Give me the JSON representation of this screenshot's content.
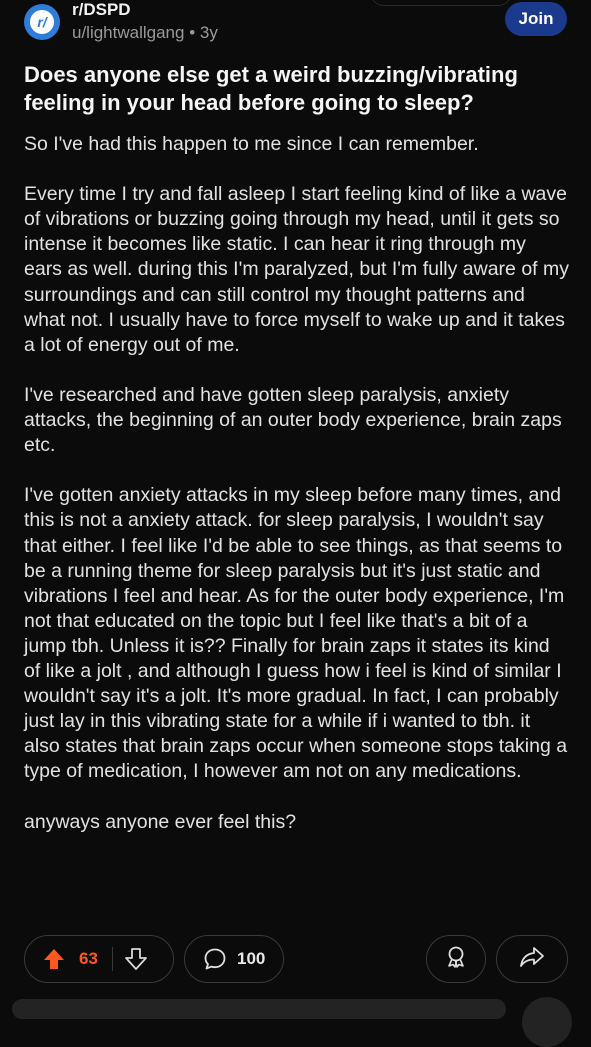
{
  "post": {
    "subreddit": "r/DSPD",
    "author": "u/lightwallgang",
    "age": "3y",
    "meta_separator": "•",
    "join_label": "Join",
    "title": "Does anyone else get a weird buzzing/vibrating feeling in your head before going to sleep?",
    "paragraphs": [
      "So I've had this happen to me since I can remember.",
      "Every time I try and fall asleep I start feeling kind of like a wave of vibrations or buzzing going through my head, until it gets so intense it becomes like static. I can hear it ring through my ears as well. during this I'm paralyzed, but I'm fully aware of my surroundings and can still control my thought patterns and what not. I usually have to force myself to wake up and it takes a lot of energy out of me.",
      "I've researched and have gotten sleep paralysis, anxiety attacks, the beginning of an outer body experience, brain zaps etc.",
      "I've gotten anxiety attacks in my sleep before many times, and this is not a anxiety attack. for sleep paralysis, I wouldn't say that either. I feel like I'd be able to see things, as that seems to be a running theme for sleep paralysis but it's just static and vibrations I feel and hear. As for the outer body experience, I'm not that educated on the topic but I feel like that's a bit of a jump tbh. Unless it is?? Finally for brain zaps it states its kind of like a jolt , and although I guess how i feel is kind of similar I wouldn't say it's a jolt. It's more gradual. In fact, I can probably just lay in this vibrating state for a while if i wanted to tbh. it also states that brain zaps occur when someone stops taking a type of medication, I however am not on any medications.",
      "anyways anyone ever feel this?"
    ]
  },
  "actions": {
    "score": "63",
    "comment_count": "100"
  },
  "icons": {
    "subreddit_avatar": "reddit-community-icon",
    "upvote": "upvote-arrow-icon",
    "downvote": "downvote-arrow-icon",
    "comments": "speech-bubble-icon",
    "award": "award-ribbon-icon",
    "share": "share-arrow-icon"
  },
  "colors": {
    "background": "#0b0b0b",
    "join_button": "#1c3a8d",
    "upvote_active": "#ff5722",
    "subreddit_avatar": "#2f7ddb"
  }
}
